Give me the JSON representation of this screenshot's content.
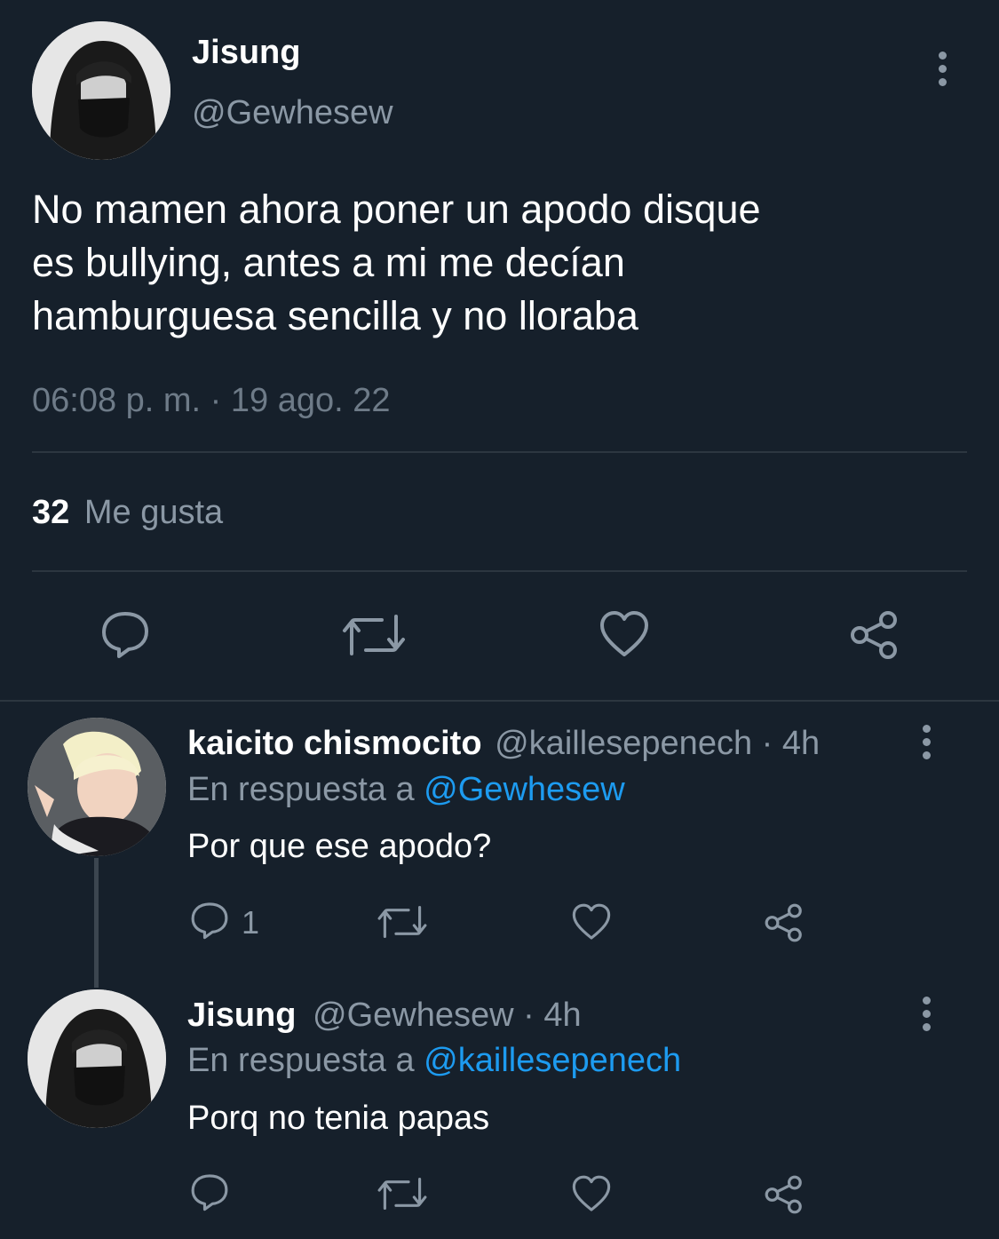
{
  "main_tweet": {
    "author_name": "Jisung",
    "author_handle": "@Gewhesew",
    "text_line1": "No mamen ahora poner un apodo disque",
    "text_line2": "es bullying, antes a mi me decían",
    "text_line3": "hamburguesa sencilla y no lloraba",
    "timestamp": "06:08 p. m. · 19 ago. 22",
    "likes_count": "32",
    "likes_label": "Me gusta"
  },
  "replies": [
    {
      "author_name": "kaicito chismocito",
      "author_handle": "@kaillesepenech",
      "time": "· 4h",
      "reply_prefix": "En respuesta a",
      "reply_to": "@Gewhesew",
      "text": "Por que ese apodo?",
      "reply_count": "1"
    },
    {
      "author_name": "Jisung",
      "author_handle": "@Gewhesew",
      "time": "· 4h",
      "reply_prefix": "En respuesta a",
      "reply_to": "@kaillesepenech",
      "text": "Porq no tenia papas"
    }
  ],
  "colors": {
    "background": "#16202b",
    "muted": "#8b98a5",
    "accent": "#1d9bf0",
    "divider": "#2c3640"
  },
  "icons": [
    "comment-icon",
    "retweet-icon",
    "heart-icon",
    "share-icon",
    "more-icon"
  ]
}
